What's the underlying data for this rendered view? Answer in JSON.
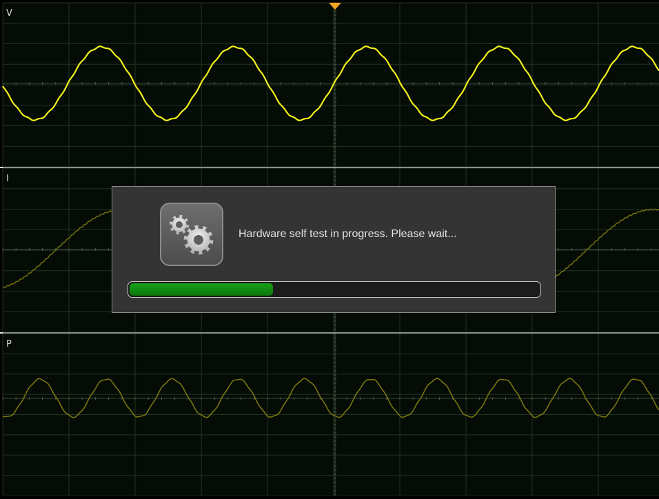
{
  "channels": [
    {
      "label": "V",
      "color": "#f2f21a"
    },
    {
      "label": "I",
      "color": "#6e6a0e"
    },
    {
      "label": "P",
      "color": "#7a7610"
    }
  ],
  "dialog": {
    "message": "Hardware self test in progress. Please wait...",
    "icon": "gears-icon",
    "progress": 0.35,
    "progress_color": "#139013"
  },
  "trigger_marker_color": "#f5a623"
}
